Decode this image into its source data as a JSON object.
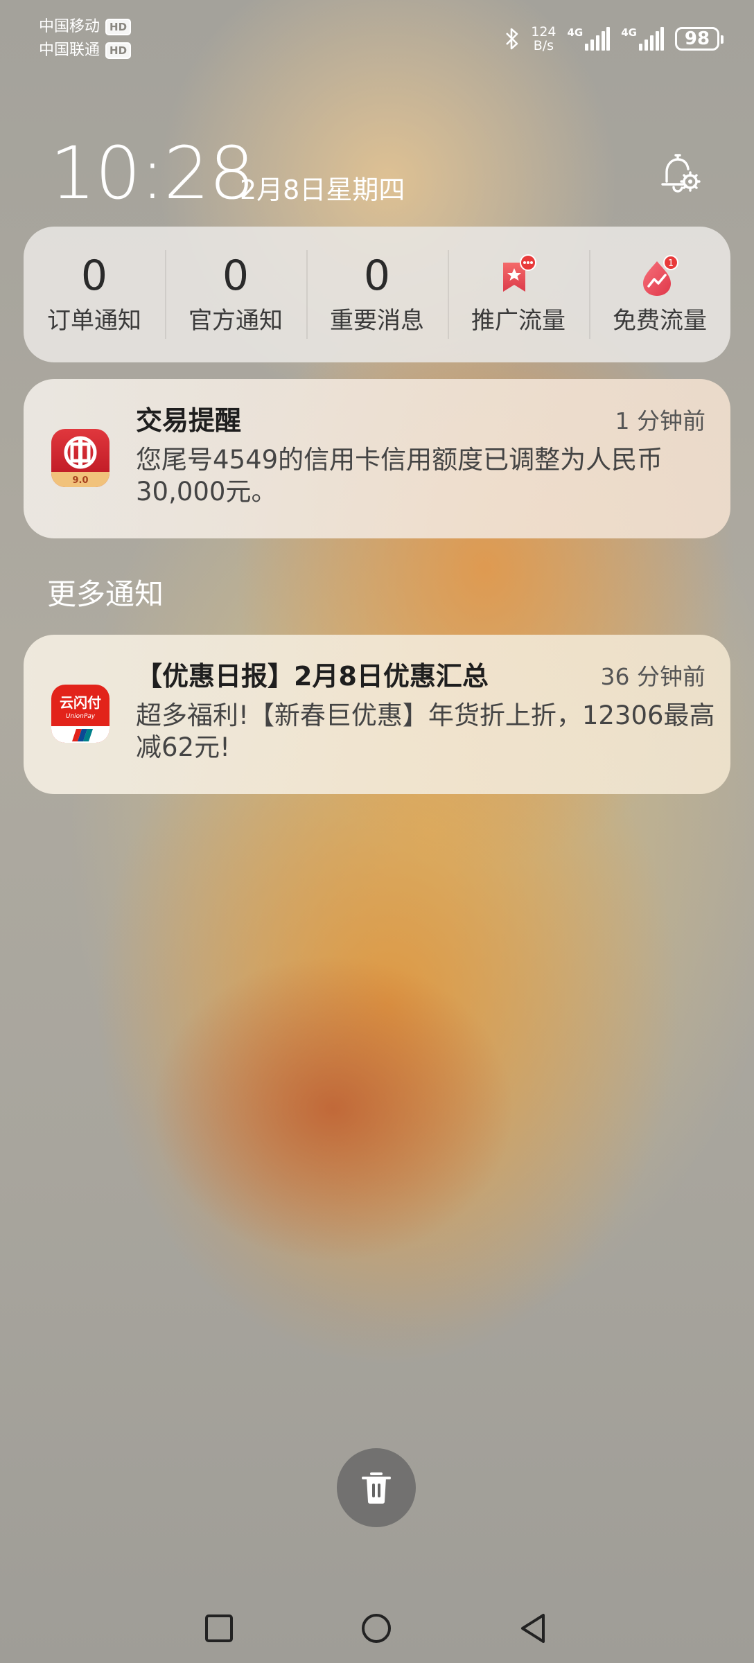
{
  "status_bar": {
    "carrier1": "中国移动",
    "carrier2": "中国联通",
    "hd_badge": "HD",
    "net_speed_value": "124",
    "net_speed_unit": "B/s",
    "sim1_network": "4G",
    "sim2_network": "4G",
    "battery": "98"
  },
  "header": {
    "time": "10:28",
    "date": "2月8日星期四"
  },
  "summary": [
    {
      "count": "0",
      "label": "订单通知"
    },
    {
      "count": "0",
      "label": "官方通知"
    },
    {
      "count": "0",
      "label": "重要消息"
    },
    {
      "label": "推广流量",
      "icon": "promo-bookmark-icon",
      "badge": "···"
    },
    {
      "label": "免费流量",
      "icon": "free-traffic-icon",
      "badge": "1"
    }
  ],
  "notifications": [
    {
      "app_icon": "icbc-bank-icon",
      "app_icon_text": "9.0",
      "title": "交易提醒",
      "time": "1 分钟前",
      "body": "您尾号4549的信用卡信用额度已调整为人民币30,000元。"
    },
    {
      "app_icon": "unionpay-cloud-quickpass-icon",
      "app_icon_text": "云闪付",
      "app_icon_subtext": "UnionPay",
      "title": "【优惠日报】2月8日优惠汇总",
      "time": "36 分钟前",
      "body": "超多福利!【新春巨优惠】年货折上折，12306最高减62元!"
    }
  ],
  "more_notifications_label": "更多通知",
  "colors": {
    "card_bg": "#e8e6e2",
    "badge_red": "#e83a3a",
    "icbc_red": "#c8161d",
    "unionpay_red": "#e2231a"
  }
}
